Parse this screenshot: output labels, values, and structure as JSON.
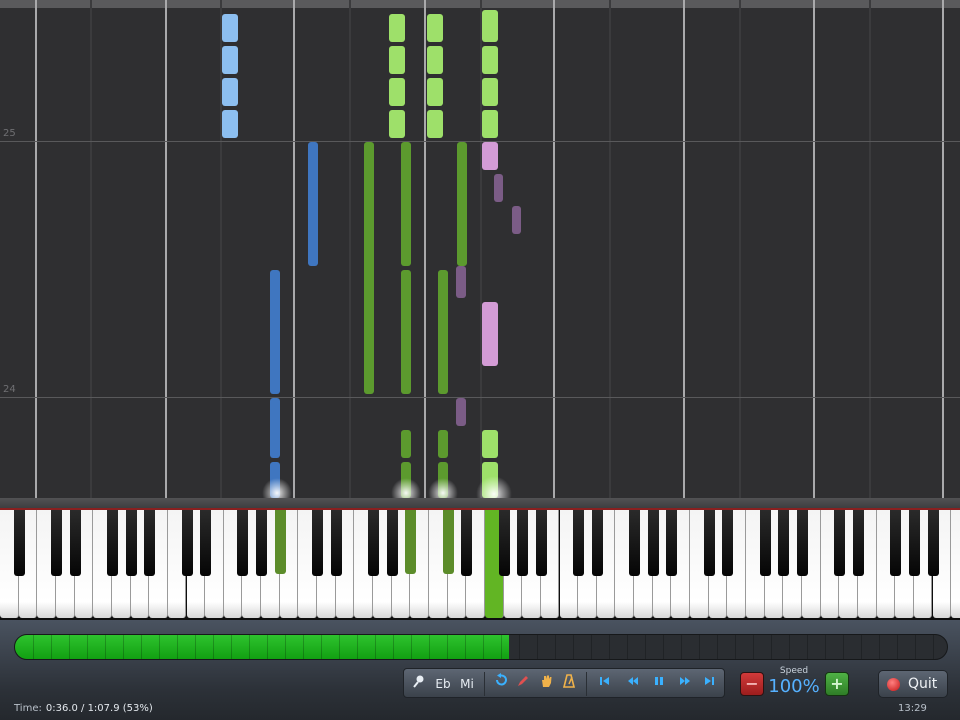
{
  "roll": {
    "measures": [
      "25",
      "24"
    ],
    "colors": {
      "lh_light": "#8dbff0",
      "lh_dark": "#3f76c0",
      "rh_light": "#9ee06a",
      "rh_dark": "#5c9a2e",
      "accent_light": "#d49cd6",
      "accent_dark": "#7b5c86"
    }
  },
  "footer": {
    "progress_percent": 53,
    "toolbar": {
      "item1_label": "Eb",
      "item2_label": "Mi",
      "icons": [
        "tempo-icon",
        "undo-icon",
        "pencil-icon",
        "hand-icon",
        "metronome-icon",
        "skip-start-icon",
        "rewind-icon",
        "pause-icon",
        "fast-forward-icon",
        "skip-end-icon"
      ]
    },
    "speed": {
      "label": "Speed",
      "value": "100%",
      "minus": "−",
      "plus": "+"
    },
    "quit_label": "Quit",
    "time_label": "Time:",
    "time_value": "0:36.0 / 1:07.9 (53%)",
    "clock": "13:29"
  }
}
